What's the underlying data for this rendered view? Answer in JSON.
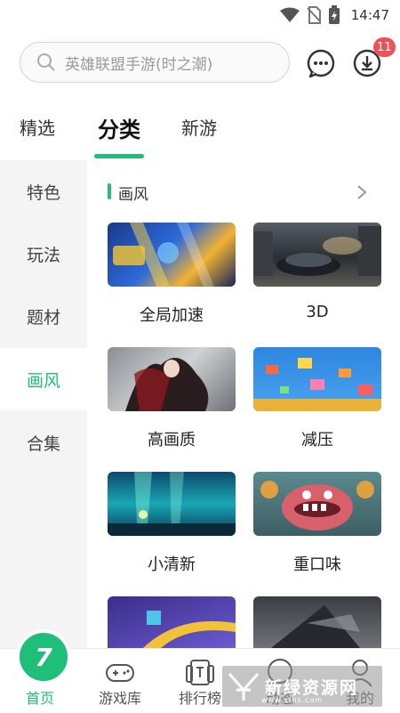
{
  "status": {
    "time": "14:47"
  },
  "search": {
    "placeholder": "英雄联盟手游(时之潮)"
  },
  "header": {
    "download_badge": "11"
  },
  "top_tabs": [
    {
      "label": "精选"
    },
    {
      "label": "分类"
    },
    {
      "label": "新游"
    }
  ],
  "sidebar": {
    "items": [
      {
        "label": "特色"
      },
      {
        "label": "玩法"
      },
      {
        "label": "题材"
      },
      {
        "label": "画风"
      },
      {
        "label": "合集"
      }
    ]
  },
  "section": {
    "title": "画风"
  },
  "cards": [
    {
      "label": "全局加速"
    },
    {
      "label": "3D"
    },
    {
      "label": "高画质"
    },
    {
      "label": "减压"
    },
    {
      "label": "小清新"
    },
    {
      "label": "重口味"
    }
  ],
  "bottom_nav": {
    "items": [
      {
        "label": "首页"
      },
      {
        "label": "游戏库"
      },
      {
        "label": "排行榜"
      },
      {
        "label": "动态"
      },
      {
        "label": "我的"
      }
    ]
  },
  "watermark": {
    "text": "新绿资源网",
    "sub": "www.xlhs.com"
  },
  "colors": {
    "accent": "#1fbf7a",
    "badge": "#f0505a"
  }
}
